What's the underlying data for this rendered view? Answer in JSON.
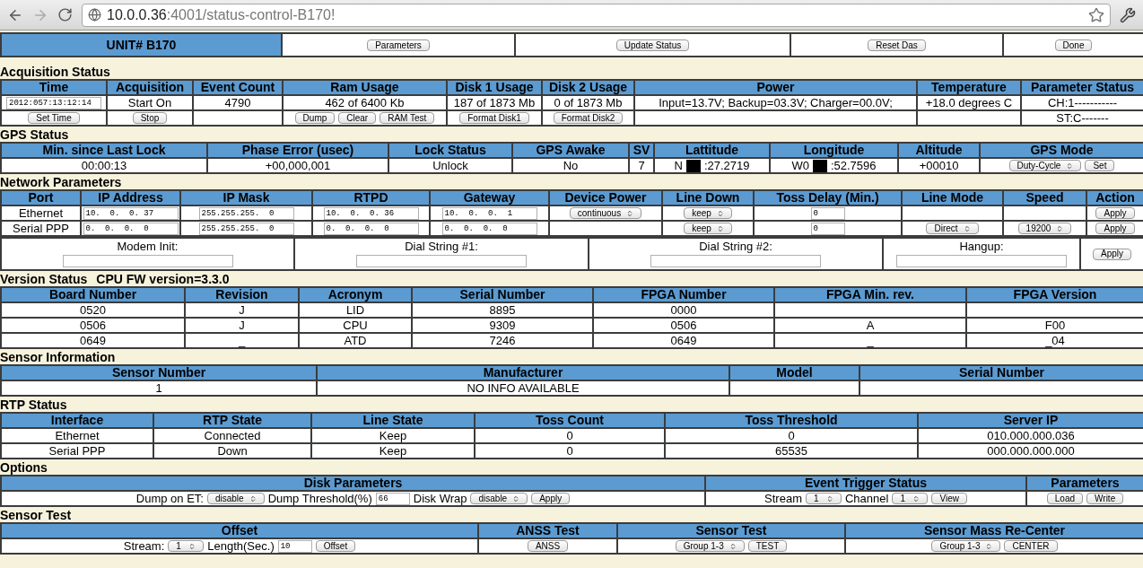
{
  "browser": {
    "url_host": "10.0.0.36",
    "url_path": ":4001/status-control-B170!"
  },
  "top_bar": {
    "unit": "UNIT# B170",
    "buttons": [
      "Parameters",
      "Update Status",
      "Reset Das",
      "Done"
    ]
  },
  "sections": [
    {
      "title": "Acquisition Status",
      "tables": [
        {
          "columns": [
            "Time",
            "Acquisition",
            "Event Count",
            "Ram Usage",
            "Disk 1 Usage",
            "Disk 2 Usage",
            "Power",
            "Temperature",
            "Parameter Status"
          ],
          "rows": [
            [
              [
                {
                  "kind": "input",
                  "value": "2012:057:13:12:14"
                }
              ],
              "Start On",
              "4790",
              "462 of 6400 Kb",
              "187 of 1873 Mb",
              "0 of 1873 Mb",
              "Input=13.7V; Backup=03.3V; Charger=00.0V;",
              "+18.0 degrees C",
              "CH:1-----------"
            ],
            [
              [
                {
                  "kind": "button",
                  "label": "Set Time"
                }
              ],
              [
                {
                  "kind": "button",
                  "label": "Stop"
                }
              ],
              null,
              [
                {
                  "kind": "button",
                  "label": "Dump"
                },
                {
                  "kind": "button",
                  "label": "Clear"
                },
                {
                  "kind": "button",
                  "label": "RAM Test"
                }
              ],
              [
                {
                  "kind": "button",
                  "label": "Format Disk1"
                }
              ],
              [
                {
                  "kind": "button",
                  "label": "Format Disk2"
                }
              ],
              null,
              null,
              "ST:C-------"
            ]
          ]
        }
      ]
    },
    {
      "title": "GPS Status",
      "tables": [
        {
          "columns": [
            "Min. since Last Lock",
            "Phase Error (usec)",
            "Lock Status",
            "GPS Awake",
            "SV",
            "Lattitude",
            "Longitude",
            "Altitude",
            "GPS Mode"
          ],
          "rows": [
            [
              "00:00:13",
              "+00,000,001",
              "Unlock",
              "No",
              "7",
              [
                {
                  "kind": "text",
                  "text": "N"
                },
                {
                  "kind": "redacted"
                },
                {
                  "kind": "text",
                  "text": ":27.2719"
                }
              ],
              [
                {
                  "kind": "text",
                  "text": "W0"
                },
                {
                  "kind": "redacted"
                },
                {
                  "kind": "text",
                  "text": ":52.7596"
                }
              ],
              "+00010",
              [
                {
                  "kind": "select",
                  "value": "Duty-Cycle"
                },
                {
                  "kind": "button",
                  "label": "Set"
                }
              ]
            ]
          ]
        }
      ]
    },
    {
      "title": "Network Parameters",
      "tables": [
        {
          "columns": [
            "Port",
            "IP Address",
            "IP Mask",
            "RTPD",
            "Gateway",
            "Device Power",
            "Line Down",
            "Toss Delay (Min.)",
            "Line Mode",
            "Speed",
            "Action"
          ],
          "rows": [
            [
              "Ethernet",
              [
                {
                  "kind": "input",
                  "value": "10.  0.  0. 37"
                }
              ],
              [
                {
                  "kind": "input",
                  "value": "255.255.255.  0"
                }
              ],
              [
                {
                  "kind": "input",
                  "value": "10.  0.  0. 36"
                }
              ],
              [
                {
                  "kind": "input",
                  "value": "10.  0.  0.  1"
                }
              ],
              [
                {
                  "kind": "select",
                  "value": "continuous"
                }
              ],
              [
                {
                  "kind": "select",
                  "value": "keep"
                }
              ],
              [
                {
                  "kind": "input",
                  "value": "0"
                }
              ],
              null,
              null,
              [
                {
                  "kind": "button",
                  "label": "Apply"
                }
              ]
            ],
            [
              "Serial PPP",
              [
                {
                  "kind": "input",
                  "value": "0.  0.  0.  0"
                }
              ],
              [
                {
                  "kind": "input",
                  "value": "255.255.255.  0"
                }
              ],
              [
                {
                  "kind": "input",
                  "value": "0.  0.  0.  0"
                }
              ],
              [
                {
                  "kind": "input",
                  "value": "0.  0.  0.  0"
                }
              ],
              null,
              [
                {
                  "kind": "select",
                  "value": "keep"
                }
              ],
              [
                {
                  "kind": "input",
                  "value": "0"
                }
              ],
              [
                {
                  "kind": "select",
                  "value": "Direct"
                }
              ],
              [
                {
                  "kind": "select",
                  "value": "19200"
                }
              ],
              [
                {
                  "kind": "button",
                  "label": "Apply"
                }
              ]
            ]
          ]
        },
        {
          "rows": [
            [
              [
                {
                  "kind": "label",
                  "text": "Modem Init:"
                },
                {
                  "kind": "input"
                }
              ],
              [
                {
                  "kind": "label",
                  "text": "Dial String #1:"
                },
                {
                  "kind": "input"
                }
              ],
              [
                {
                  "kind": "label",
                  "text": "Dial String #2:"
                },
                {
                  "kind": "input"
                }
              ],
              [
                {
                  "kind": "label",
                  "text": "Hangup:"
                },
                {
                  "kind": "input"
                }
              ],
              [
                {
                  "kind": "button",
                  "label": "Apply"
                }
              ]
            ]
          ]
        }
      ]
    },
    {
      "title": "Version Status",
      "subtitle": "CPU FW version=3.3.0",
      "tables": [
        {
          "columns": [
            "Board Number",
            "Revision",
            "Acronym",
            "Serial Number",
            "FPGA Number",
            "FPGA Min. rev.",
            "FPGA Version"
          ],
          "rows": [
            [
              "0520",
              "J",
              "LID",
              "8895",
              "0000",
              null,
              null
            ],
            [
              "0506",
              "J",
              "CPU",
              "9309",
              "0506",
              "A",
              "F00"
            ],
            [
              "0649",
              "_",
              "ATD",
              "7246",
              "0649",
              "_",
              "_04"
            ]
          ]
        }
      ]
    },
    {
      "title": "Sensor Information",
      "tables": [
        {
          "columns": [
            "Sensor Number",
            "Manufacturer",
            "Model",
            "Serial Number"
          ],
          "rows": [
            [
              "1",
              "NO INFO AVAILABLE",
              null,
              null
            ]
          ]
        }
      ]
    },
    {
      "title": "RTP Status",
      "tables": [
        {
          "columns": [
            "Interface",
            "RTP State",
            "Line State",
            "Toss Count",
            "Toss Threshold",
            "Server IP"
          ],
          "rows": [
            [
              "Ethernet",
              "Connected",
              "Keep",
              "0",
              "0",
              "010.000.000.036"
            ],
            [
              "Serial PPP",
              "Down",
              "Keep",
              "0",
              "65535",
              "000.000.000.000"
            ]
          ]
        }
      ]
    },
    {
      "title": "Options",
      "tables": [
        {
          "columns": [
            "Disk Parameters",
            "Event Trigger Status",
            "Parameters"
          ],
          "rows": [
            [
              [
                {
                  "kind": "text",
                  "text": "Dump on ET:"
                },
                {
                  "kind": "select",
                  "value": "disable"
                },
                {
                  "kind": "text",
                  "text": "Dump Threshold(%)"
                },
                {
                  "kind": "input",
                  "value": "66"
                },
                {
                  "kind": "text",
                  "text": "Disk Wrap"
                },
                {
                  "kind": "select",
                  "value": "disable"
                },
                {
                  "kind": "button",
                  "label": "Apply"
                }
              ],
              [
                {
                  "kind": "text",
                  "text": "Stream"
                },
                {
                  "kind": "select",
                  "value": "1"
                },
                {
                  "kind": "text",
                  "text": "Channel"
                },
                {
                  "kind": "select",
                  "value": "1"
                },
                {
                  "kind": "button",
                  "label": "View"
                }
              ],
              [
                {
                  "kind": "button",
                  "label": "Load"
                },
                {
                  "kind": "button",
                  "label": "Write"
                }
              ]
            ]
          ]
        }
      ]
    },
    {
      "title": "Sensor Test",
      "tables": [
        {
          "columns": [
            "Offset",
            "ANSS Test",
            "Sensor Test",
            "Sensor Mass Re-Center"
          ],
          "rows": [
            [
              [
                {
                  "kind": "text",
                  "text": "Stream:"
                },
                {
                  "kind": "select",
                  "value": "1"
                },
                {
                  "kind": "text",
                  "text": "Length(Sec.)"
                },
                {
                  "kind": "input",
                  "value": "10"
                },
                {
                  "kind": "button",
                  "label": "Offset"
                }
              ],
              [
                {
                  "kind": "button",
                  "label": "ANSS"
                }
              ],
              [
                {
                  "kind": "select",
                  "value": "Group 1-3"
                },
                {
                  "kind": "button",
                  "label": "TEST"
                }
              ],
              [
                {
                  "kind": "select",
                  "value": "Group 1-3"
                },
                {
                  "kind": "button",
                  "label": "CENTER"
                }
              ]
            ]
          ]
        }
      ]
    }
  ]
}
